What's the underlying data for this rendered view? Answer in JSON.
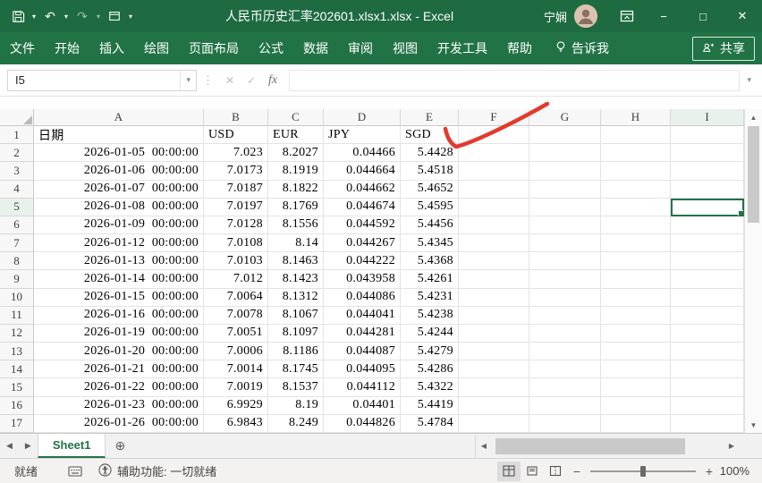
{
  "title_bar": {
    "title": "人民币历史汇率202601.xlsx1.xlsx - Excel",
    "user_name": "宁娴"
  },
  "ribbon": {
    "tabs": [
      "文件",
      "开始",
      "插入",
      "绘图",
      "页面布局",
      "公式",
      "数据",
      "审阅",
      "视图",
      "开发工具",
      "帮助"
    ],
    "tell_me_label": "告诉我",
    "share_label": "共享"
  },
  "formula_bar": {
    "name_box": "I5",
    "fx_label": "fx",
    "formula": ""
  },
  "grid": {
    "column_headers": [
      "A",
      "B",
      "C",
      "D",
      "E",
      "F",
      "G",
      "H",
      "I"
    ],
    "rows": [
      {
        "n": "1",
        "cells": [
          "日期",
          "USD",
          "EUR",
          "JPY",
          "SGD"
        ]
      },
      {
        "n": "2",
        "cells": [
          "2026-01-05  00:00:00",
          "7.023",
          "8.2027",
          "0.04466",
          "5.4428"
        ]
      },
      {
        "n": "3",
        "cells": [
          "2026-01-06  00:00:00",
          "7.0173",
          "8.1919",
          "0.044664",
          "5.4518"
        ]
      },
      {
        "n": "4",
        "cells": [
          "2026-01-07  00:00:00",
          "7.0187",
          "8.1822",
          "0.044662",
          "5.4652"
        ]
      },
      {
        "n": "5",
        "cells": [
          "2026-01-08  00:00:00",
          "7.0197",
          "8.1769",
          "0.044674",
          "5.4595"
        ]
      },
      {
        "n": "6",
        "cells": [
          "2026-01-09  00:00:00",
          "7.0128",
          "8.1556",
          "0.044592",
          "5.4456"
        ]
      },
      {
        "n": "7",
        "cells": [
          "2026-01-12  00:00:00",
          "7.0108",
          "8.14",
          "0.044267",
          "5.4345"
        ]
      },
      {
        "n": "8",
        "cells": [
          "2026-01-13  00:00:00",
          "7.0103",
          "8.1463",
          "0.044222",
          "5.4368"
        ]
      },
      {
        "n": "9",
        "cells": [
          "2026-01-14  00:00:00",
          "7.012",
          "8.1423",
          "0.043958",
          "5.4261"
        ]
      },
      {
        "n": "10",
        "cells": [
          "2026-01-15  00:00:00",
          "7.0064",
          "8.1312",
          "0.044086",
          "5.4231"
        ]
      },
      {
        "n": "11",
        "cells": [
          "2026-01-16  00:00:00",
          "7.0078",
          "8.1067",
          "0.044041",
          "5.4238"
        ]
      },
      {
        "n": "12",
        "cells": [
          "2026-01-19  00:00:00",
          "7.0051",
          "8.1097",
          "0.044281",
          "5.4244"
        ]
      },
      {
        "n": "13",
        "cells": [
          "2026-01-20  00:00:00",
          "7.0006",
          "8.1186",
          "0.044087",
          "5.4279"
        ]
      },
      {
        "n": "14",
        "cells": [
          "2026-01-21  00:00:00",
          "7.0014",
          "8.1745",
          "0.044095",
          "5.4286"
        ]
      },
      {
        "n": "15",
        "cells": [
          "2026-01-22  00:00:00",
          "7.0019",
          "8.1537",
          "0.044112",
          "5.4322"
        ]
      },
      {
        "n": "16",
        "cells": [
          "2026-01-23  00:00:00",
          "6.9929",
          "8.19",
          "0.04401",
          "5.4419"
        ]
      },
      {
        "n": "17",
        "cells": [
          "2026-01-26  00:00:00",
          "6.9843",
          "8.249",
          "0.044826",
          "5.4784"
        ]
      }
    ]
  },
  "sheet_bar": {
    "active_tab": "Sheet1"
  },
  "status_bar": {
    "ready_label": "就绪",
    "accessibility_label": "辅助功能: 一切就绪",
    "zoom_label": "100%"
  },
  "icons": {
    "caret_down": "▾",
    "undo": "↶",
    "redo": "↷",
    "minimize": "−",
    "maximize": "□",
    "close": "✕",
    "cancel": "✕",
    "enter": "✓",
    "dots": "⋮",
    "formula_expand": "▾",
    "prev_sheet": "◀",
    "next_sheet": "▶",
    "add_sheet": "⊕",
    "scroll_up": "▲",
    "scroll_down": "▼",
    "scroll_left": "◀",
    "scroll_right": "▶",
    "zoom_out": "−",
    "zoom_in": "+"
  },
  "colors": {
    "excel_green": "#217346",
    "title_green": "#1e6b41",
    "annotation_red": "#e23a2c"
  }
}
